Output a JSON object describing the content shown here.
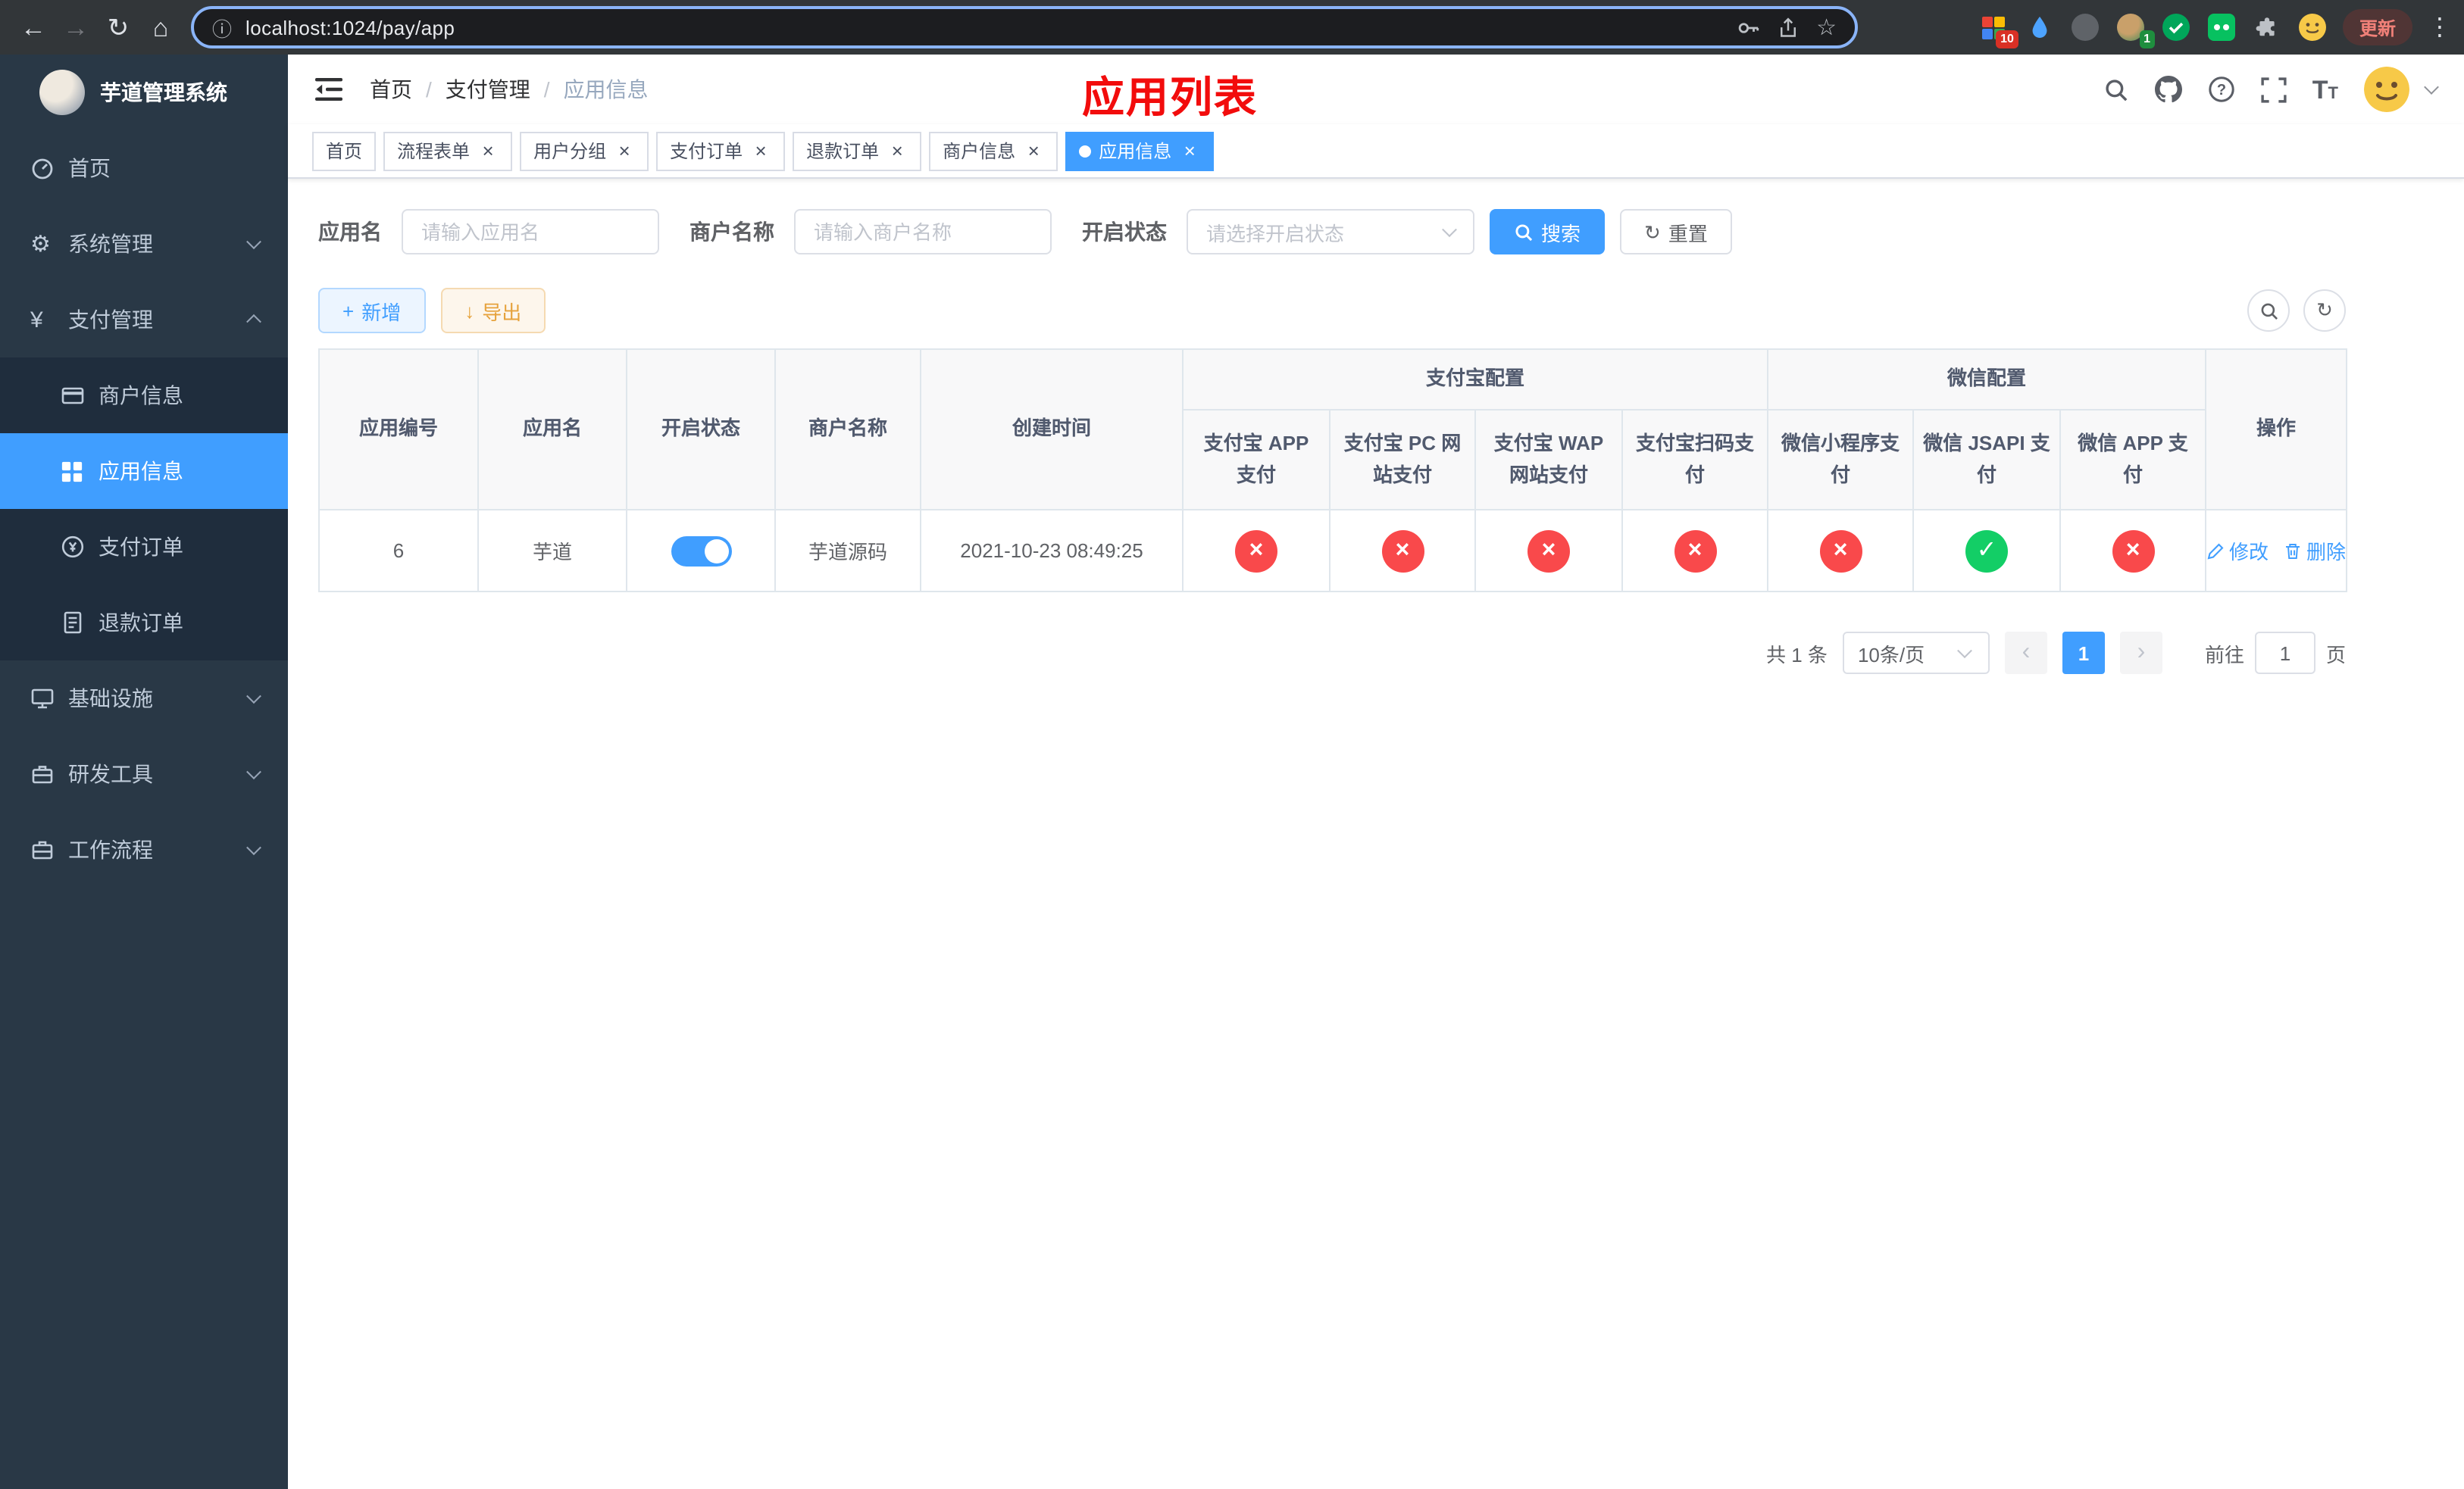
{
  "browser": {
    "url": "localhost:1024/pay/app",
    "update_label": "更新",
    "ext_badge_grid": "10",
    "ext_badge_avatar": "1"
  },
  "icons": {
    "back": "←",
    "forward": "→",
    "reload": "↻",
    "home": "⌂",
    "info": "ⓘ",
    "star": "☆",
    "more": "⋮",
    "close": "×",
    "cross": "×",
    "check": "✓",
    "plus": "+",
    "download": "↓",
    "refresh": "↻",
    "prev": "‹",
    "next": "›",
    "gear": "⚙",
    "yen": "¥"
  },
  "sidebar": {
    "logo_title": "芋道管理系统",
    "items": {
      "home": "首页",
      "system": "系统管理",
      "pay": "支付管理",
      "infra": "基础设施",
      "dev": "研发工具",
      "workflow": "工作流程"
    },
    "submenu": {
      "merchant": "商户信息",
      "app": "应用信息",
      "order": "支付订单",
      "refund": "退款订单"
    }
  },
  "header": {
    "breadcrumb": [
      "首页",
      "支付管理",
      "应用信息"
    ],
    "breadcrumb_sep": "/",
    "overlay_title": "应用列表"
  },
  "tabs": [
    {
      "label": "首页",
      "closable": false,
      "active": false
    },
    {
      "label": "流程表单",
      "closable": true,
      "active": false
    },
    {
      "label": "用户分组",
      "closable": true,
      "active": false
    },
    {
      "label": "支付订单",
      "closable": true,
      "active": false
    },
    {
      "label": "退款订单",
      "closable": true,
      "active": false
    },
    {
      "label": "商户信息",
      "closable": true,
      "active": false
    },
    {
      "label": "应用信息",
      "closable": true,
      "active": true
    }
  ],
  "filters": {
    "app_name_label": "应用名",
    "app_name_placeholder": "请输入应用名",
    "merchant_label": "商户名称",
    "merchant_placeholder": "请输入商户名称",
    "status_label": "开启状态",
    "status_placeholder": "请选择开启状态",
    "search_button": "搜索",
    "reset_button": "重置"
  },
  "toolbar": {
    "add_button": "新增",
    "export_button": "导出"
  },
  "table": {
    "group_alipay": "支付宝配置",
    "group_wechat": "微信配置",
    "col_app_id": "应用编号",
    "col_app_name": "应用名",
    "col_status": "开启状态",
    "col_merchant": "商户名称",
    "col_create_time": "创建时间",
    "col_alipay_app": "支付宝 APP 支付",
    "col_alipay_pc": "支付宝 PC 网站支付",
    "col_alipay_wap": "支付宝 WAP 网站支付",
    "col_alipay_qr": "支付宝扫码支付",
    "col_wx_mini": "微信小程序支付",
    "col_wx_jsapi": "微信 JSAPI 支付",
    "col_wx_app": "微信 APP 支付",
    "col_ops": "操作",
    "rows": [
      {
        "app_id": "6",
        "app_name": "芋道",
        "status_on": true,
        "merchant": "芋道源码",
        "create_time": "2021-10-23 08:49:25",
        "alipay_app": false,
        "alipay_pc": false,
        "alipay_wap": false,
        "alipay_qr": false,
        "wx_mini": false,
        "wx_jsapi": true,
        "wx_app": false,
        "edit_label": "修改",
        "delete_label": "删除"
      }
    ]
  },
  "pagination": {
    "total_text": "共 1 条",
    "page_size": "10条/页",
    "page": "1",
    "goto_prefix": "前往",
    "goto_value": "1",
    "goto_suffix": "页"
  },
  "colors": {
    "primary": "#409eff",
    "success": "#13ce66",
    "danger": "#f9494b",
    "warning": "#e6a23c",
    "sidebar_bg": "#293846",
    "submenu_bg": "#1f2d3d",
    "annotation_red": "#f20c0c"
  }
}
